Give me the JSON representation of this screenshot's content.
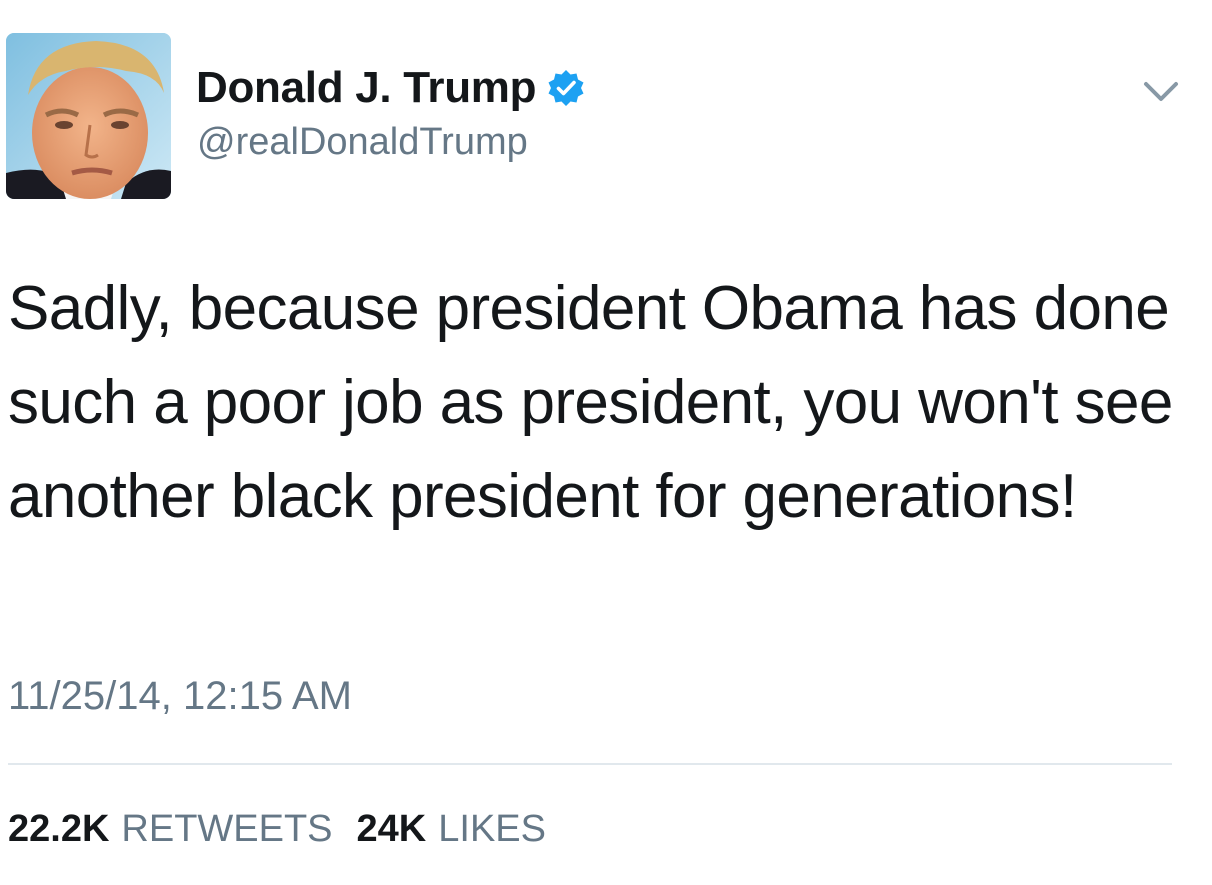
{
  "author": {
    "display_name": "Donald J. Trump",
    "handle": "@realDonaldTrump",
    "verified_icon": "verified-badge-icon",
    "avatar_icon": "profile-photo"
  },
  "menu": {
    "icon": "chevron-down-icon"
  },
  "tweet": {
    "text": "Sadly, because president Obama has done such a poor job as president, you won't see another black president for generations!",
    "timestamp": "11/25/14, 12:15 AM"
  },
  "stats": {
    "retweets_count": "22.2K",
    "retweets_label": "RETWEETS",
    "likes_count": "24K",
    "likes_label": "LIKES"
  },
  "colors": {
    "text_primary": "#14171a",
    "text_secondary": "#657786",
    "verified_blue": "#1da1f2",
    "divider": "#e1e8ed"
  }
}
